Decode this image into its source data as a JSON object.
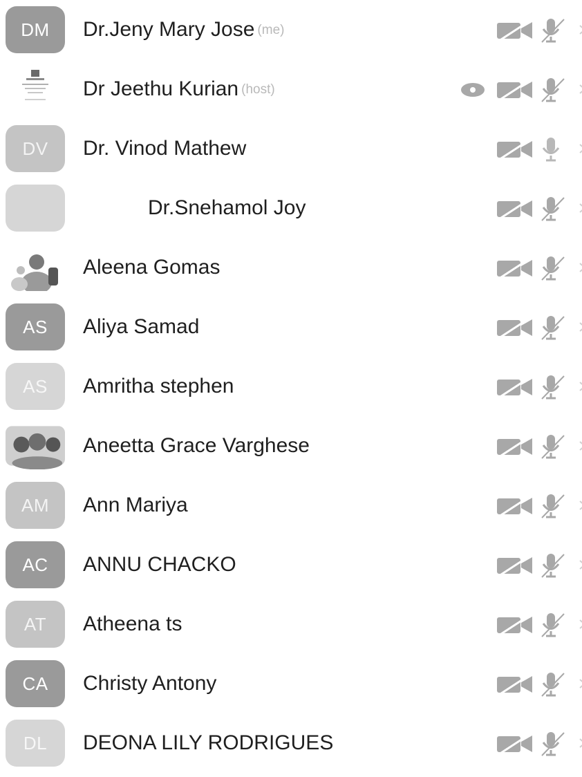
{
  "participants": [
    {
      "initials": "DM",
      "name": "Dr.Jeny Mary Jose",
      "tag": "(me)"
    },
    {
      "initials": "",
      "name": "Dr Jeethu Kurian",
      "tag": "(host)"
    },
    {
      "initials": "DV",
      "name": "Dr. Vinod Mathew",
      "tag": ""
    },
    {
      "initials": "",
      "name": "Dr.Snehamol Joy",
      "tag": ""
    },
    {
      "initials": "",
      "name": "Aleena Gomas",
      "tag": ""
    },
    {
      "initials": "AS",
      "name": "Aliya Samad",
      "tag": ""
    },
    {
      "initials": "AS",
      "name": "Amritha stephen",
      "tag": ""
    },
    {
      "initials": "",
      "name": "Aneetta Grace Varghese",
      "tag": ""
    },
    {
      "initials": "AM",
      "name": "Ann Mariya",
      "tag": ""
    },
    {
      "initials": "AC",
      "name": "ANNU CHACKO",
      "tag": ""
    },
    {
      "initials": "AT",
      "name": "Atheena ts",
      "tag": ""
    },
    {
      "initials": "CA",
      "name": "Christy Antony",
      "tag": ""
    },
    {
      "initials": "DL",
      "name": "DEONA LILY RODRIGUES",
      "tag": ""
    }
  ],
  "icons": {
    "camera": "camera-off-icon",
    "mic": "mic-off-icon",
    "share": "screen-share-icon",
    "chevron": "chevron-right-icon"
  },
  "colors": {
    "avatar_dark": "#9a9a9a",
    "avatar_light": "#c4c4c4",
    "icon_gray": "#a8a8a8",
    "tag_gray": "#b9b9b9"
  }
}
